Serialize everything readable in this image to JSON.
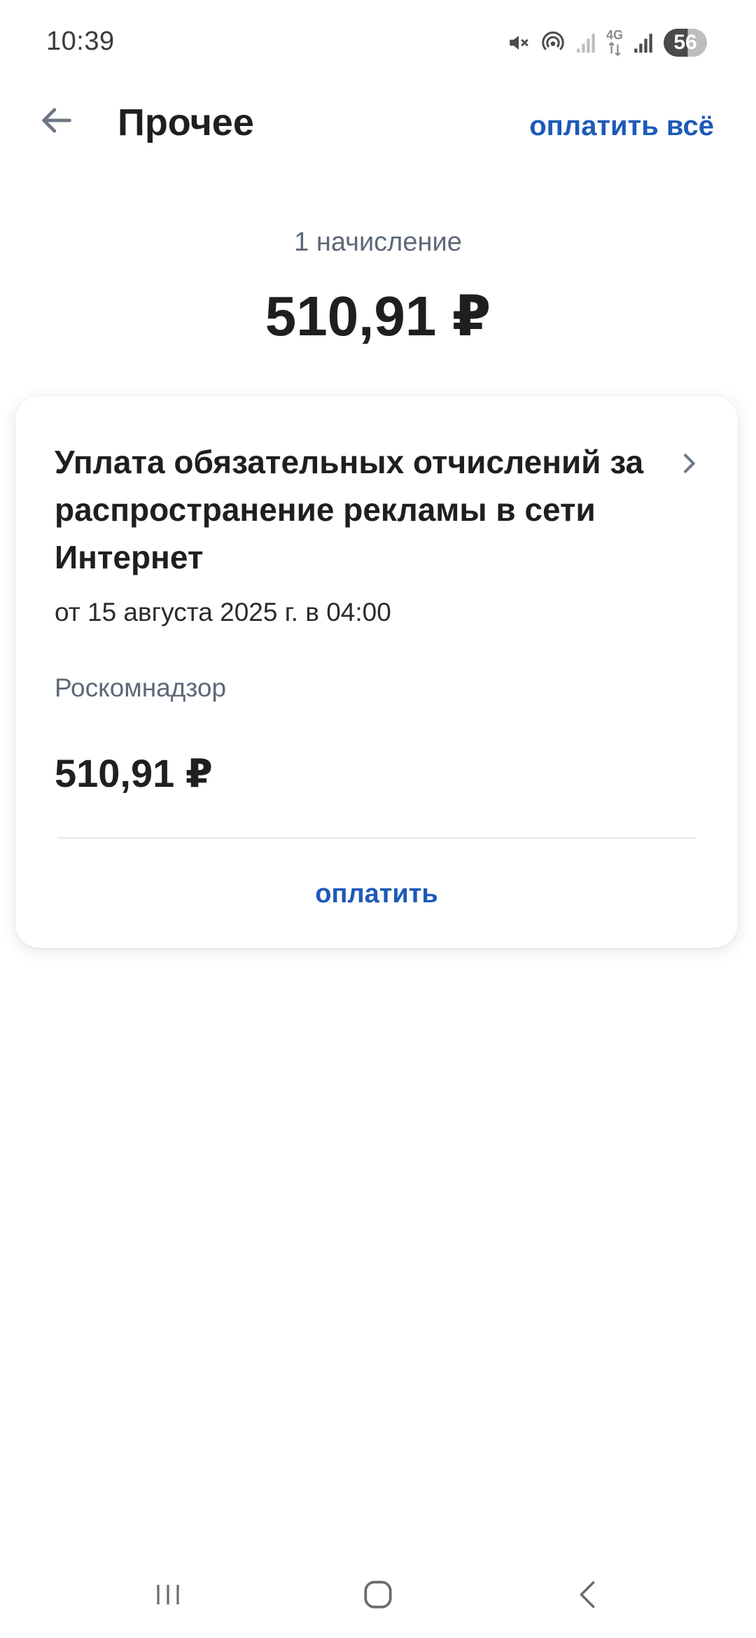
{
  "status_bar": {
    "time": "10:39",
    "network": "4G",
    "battery": "56",
    "icons": [
      "mute-icon",
      "hotspot-icon",
      "signal-icon",
      "data-arrows-icon",
      "signal-icon",
      "battery-icon"
    ]
  },
  "header": {
    "back_icon": "arrow-left-icon",
    "title": "Прочее",
    "pay_all_label": "оплатить всё"
  },
  "summary": {
    "count_text": "1 начисление",
    "total_amount": "510,91 ₽"
  },
  "charge": {
    "title": "Уплата обязательных отчислений за распространение рекламы в сети Интернет",
    "date": "от 15 августа 2025 г. в 04:00",
    "organization": "Роскомнадзор",
    "amount": "510,91 ₽",
    "pay_label": "оплатить",
    "chevron_icon": "chevron-right-icon"
  },
  "navigation": {
    "items": [
      "recents-icon",
      "home-icon",
      "back-icon"
    ]
  },
  "colors": {
    "accent": "#1d5ab8",
    "text_primary": "#1f1f1f",
    "text_secondary": "#5d6878"
  }
}
